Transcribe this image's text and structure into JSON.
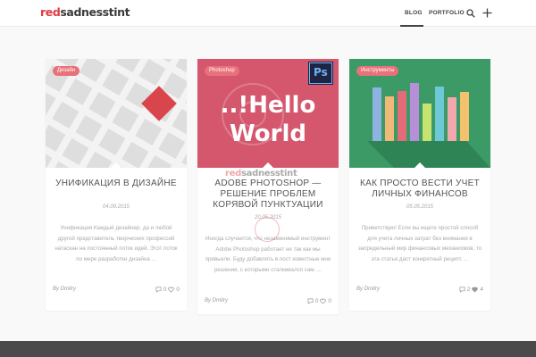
{
  "header": {
    "logo_red": "red",
    "logo_dark": "sadnesstint",
    "nav": [
      {
        "label": "BLOG",
        "active": true
      },
      {
        "label": "PORTFOLIO",
        "active": false
      }
    ],
    "icons": [
      "search-icon",
      "plus-icon"
    ]
  },
  "colors": {
    "accent": "#e23a40",
    "badge": "#e8717a",
    "footer": "#4a4a4a"
  },
  "posts": [
    {
      "category": "Дизайн",
      "title": "УНИФИКАЦИЯ В ДИЗАЙНЕ",
      "date": "04.09.2015",
      "excerpt": "Унификация Каждый дизайнер, да и любой другой представитель творческих профессий натаскан на постоянный поток идей. Этот поток по мере разработки дизайна ...",
      "author": "By Dmitry",
      "comments": "0",
      "likes": "0"
    },
    {
      "category": "Photoshop",
      "image_text": "..!Hello World",
      "ps_label": "Ps",
      "title": "ADOBE PHOTOSHOP — РЕШЕНИЕ ПРОБЛЕМ КОРЯВОЙ ПУНКТУАЦИИ",
      "date": "20.05.2015",
      "excerpt": "Иногда случается, что незаменимый инструмент Adobe Photoshop работает не так как мы привыкли. Буду добавлять в пост известные мне решения, с которыми сталкивался сам. ...",
      "author": "By Dmitry",
      "comments": "0",
      "likes": "0",
      "watermark_red": "red",
      "watermark_dark": "sadnesstint"
    },
    {
      "category": "Инструменты",
      "title": "КАК ПРОСТО ВЕСТИ УЧЕТ ЛИЧНЫХ ФИНАНСОВ",
      "date": "05.05.2015",
      "excerpt": "Приветствую! Если вы ищете простой способ для учета личных затрат без внимания в запредельный мир финансовых механизмов, то эта статья даст конкретный рецепт. ...",
      "author": "By Dmitry",
      "comments": "2",
      "likes": "4"
    }
  ]
}
